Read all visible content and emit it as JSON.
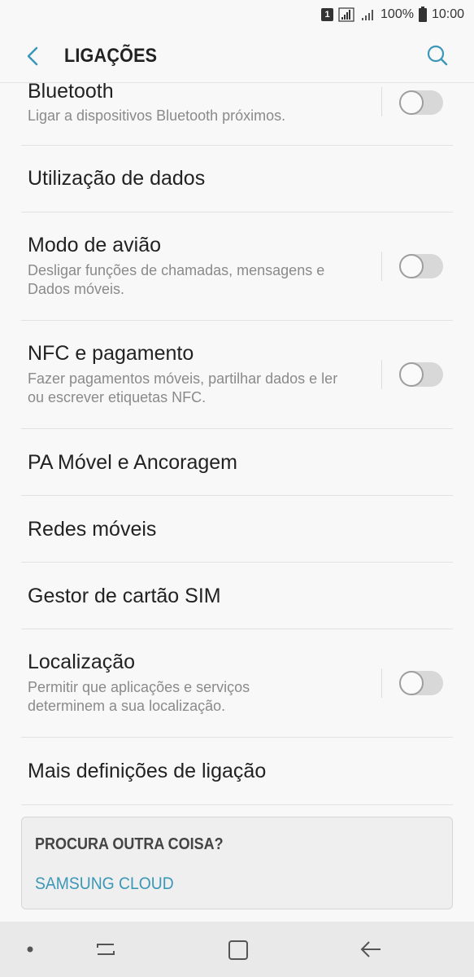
{
  "status": {
    "sim_slot": "1",
    "battery_percent": "100%",
    "time": "10:00"
  },
  "header": {
    "title": "LIGAÇÕES",
    "back_icon": "chevron-left-icon",
    "search_icon": "search-icon",
    "accent": "#3b97b8"
  },
  "items": [
    {
      "title": "Bluetooth",
      "desc": "Ligar a dispositivos Bluetooth próximos.",
      "toggle": false
    },
    {
      "title": "Utilização de dados"
    },
    {
      "title": "Modo de avião",
      "desc": "Desligar funções de chamadas, mensagens e Dados móveis.",
      "toggle": false
    },
    {
      "title": "NFC e pagamento",
      "desc": "Fazer pagamentos móveis, partilhar dados e ler ou escrever etiquetas NFC.",
      "toggle": false
    },
    {
      "title": "PA Móvel e Ancoragem"
    },
    {
      "title": "Redes móveis"
    },
    {
      "title": "Gestor de cartão SIM"
    },
    {
      "title": "Localização",
      "desc": "Permitir que aplicações e serviços determinem a sua localização.",
      "toggle": false
    },
    {
      "title": "Mais definições de ligação"
    }
  ],
  "card": {
    "title": "PROCURA OUTRA COISA?",
    "link": "SAMSUNG CLOUD"
  },
  "nav": {
    "icons": [
      "dot-icon",
      "recent-apps-icon",
      "home-icon",
      "back-arrow-icon"
    ]
  }
}
